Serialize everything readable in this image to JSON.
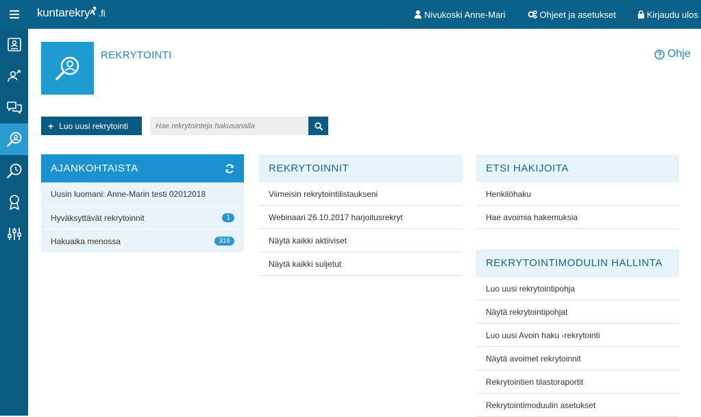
{
  "topbar": {
    "logo": "kuntarekry",
    "logo_suffix": ".fi",
    "user_name": "Nivukoski Anne-Mari",
    "settings_label": "Ohjeet ja asetukset",
    "logout_label": "Kirjaudu ulos"
  },
  "header": {
    "title": "REKRYTOINTI",
    "help_label": "Ohje"
  },
  "actions": {
    "new_button_label": "Luo uusi rekrytointi",
    "search_placeholder": "Hae rekrytointeja hakusanalla"
  },
  "ajankohtaista": {
    "title": "AJANKOHTAISTA",
    "items": [
      {
        "label": "Uusin luomani: Anne-Marin testi 02012018",
        "badge": ""
      },
      {
        "label": "Hyväksyttävät rekrytoinnit",
        "badge": "1"
      },
      {
        "label": "Hakuaika menossa",
        "badge": "316"
      }
    ]
  },
  "rekrytoinnit": {
    "title": "REKRYTOINNIT",
    "items": [
      "Viimeisin rekrytointilistaukseni",
      "Webinaari 26.10.2017 harjoitusrekryt",
      "Näytä kaikki aktiiviset",
      "Näytä kaikki suljetut"
    ]
  },
  "etsi": {
    "title": "ETSI HAKIJOITA",
    "items": [
      "Henkilöhaku",
      "Hae avoimia hakemuksia"
    ]
  },
  "hallinta": {
    "title": "REKRYTOINTIMODULIN HALLINTA",
    "items": [
      "Luo uusi rekrytointipohja",
      "Näytä rekrytointipohjat",
      "Luo uusi Avoin haku -rekrytointi",
      "Näytä avoimet rekrytoinnit",
      "Rekrytointien tilastoraportit",
      "Rekrytointimoduulin asetukset"
    ]
  },
  "colors": {
    "topbar": "#0a6189",
    "sidebar": "#0a5b82",
    "accent": "#1a92cf",
    "sidebar_active": "#2b9ad0"
  }
}
